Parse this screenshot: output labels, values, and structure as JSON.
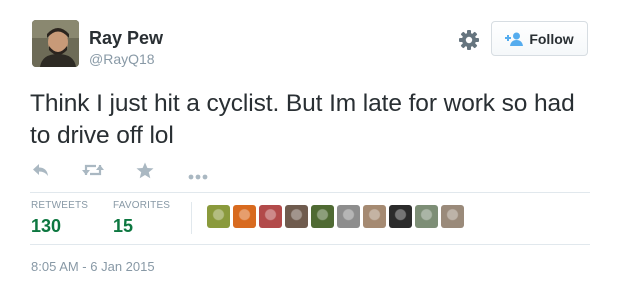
{
  "author": {
    "display_name": "Ray Pew",
    "handle": "@RayQ18",
    "avatar_icon": "profile-photo"
  },
  "follow_button": {
    "label": "Follow",
    "icon": "add-person-icon"
  },
  "settings_icon": "gear-icon",
  "tweet": {
    "text": "Think I just hit a cyclist. But Im late for work so had to drive off lol"
  },
  "actions": [
    {
      "name": "reply",
      "icon": "reply-icon"
    },
    {
      "name": "retweet",
      "icon": "retweet-icon"
    },
    {
      "name": "favorite",
      "icon": "star-icon"
    },
    {
      "name": "more",
      "icon": "more-icon"
    }
  ],
  "stats": {
    "retweets_label": "RETWEETS",
    "retweets_count": "130",
    "favorites_label": "FAVORITES",
    "favorites_count": "15"
  },
  "favoriters": [
    {
      "color": "#8a9a3c"
    },
    {
      "color": "#d86a1f"
    },
    {
      "color": "#b24a4a"
    },
    {
      "color": "#6f5b4e"
    },
    {
      "color": "#4f6a33"
    },
    {
      "color": "#8d8d8d"
    },
    {
      "color": "#a58a72"
    },
    {
      "color": "#2b2b2b"
    },
    {
      "color": "#7d8e76"
    },
    {
      "color": "#9a8a7a"
    }
  ],
  "timestamp": "8:05 AM - 6 Jan 2015",
  "colors": {
    "count_green": "#0d7740",
    "muted_gray": "#8899a6",
    "icon_gray": "#aab8c2",
    "follow_blue": "#55acee"
  }
}
